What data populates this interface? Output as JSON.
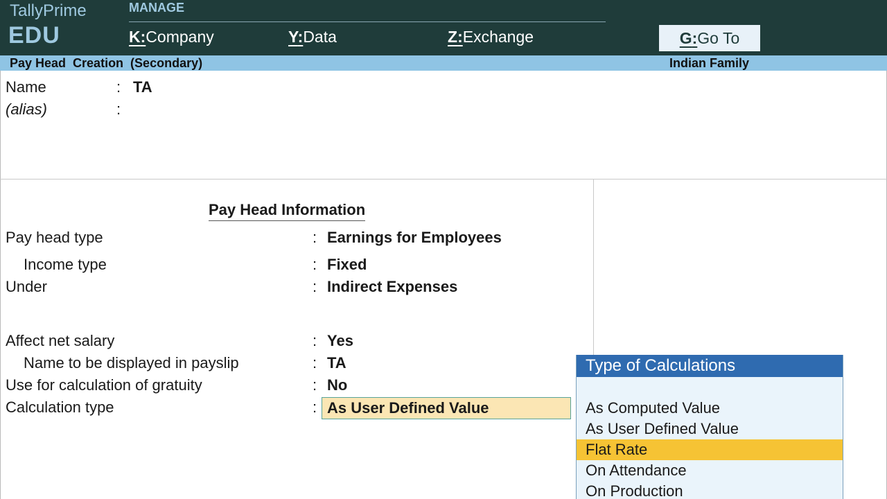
{
  "app": {
    "name": "TallyPrime",
    "edition": "EDU"
  },
  "topbar": {
    "section": "MANAGE",
    "menu": [
      {
        "key": "K",
        "label": "Company"
      },
      {
        "key": "Y",
        "label": "Data"
      },
      {
        "key": "Z",
        "label": "Exchange"
      }
    ],
    "goto": {
      "key": "G",
      "label": "Go To"
    }
  },
  "titlebar": {
    "title": "Pay Head  Creation  (Secondary)",
    "company": "Indian Family"
  },
  "form": {
    "name_label": "Name",
    "name_value": "TA",
    "alias_label": "(alias)",
    "colon": ":",
    "section_title": "Pay Head Information",
    "fields": [
      {
        "label": "Pay head type",
        "value": "Earnings for Employees"
      },
      {
        "label": "Income type",
        "value": "Fixed"
      },
      {
        "label": "Under",
        "value": "Indirect Expenses"
      },
      {
        "label": "Affect net salary",
        "value": "Yes"
      },
      {
        "label": "Name to be displayed in payslip",
        "value": "TA"
      },
      {
        "label": "Use for calculation of gratuity",
        "value": "No"
      },
      {
        "label": "Calculation type",
        "value": "As User Defined Value"
      }
    ]
  },
  "popup": {
    "title": "Type of Calculations",
    "options": [
      {
        "label": "As Computed Value",
        "selected": false
      },
      {
        "label": "As User Defined Value",
        "selected": false
      },
      {
        "label": "Flat Rate",
        "selected": true
      },
      {
        "label": "On Attendance",
        "selected": false
      },
      {
        "label": "On Production",
        "selected": false
      }
    ]
  },
  "colors": {
    "topbar": "#1f3c3a",
    "titlebar": "#8fc4e4",
    "popup_header": "#2f6bb0",
    "highlight": "#f6c334",
    "input_bg": "#fbe6b4"
  }
}
